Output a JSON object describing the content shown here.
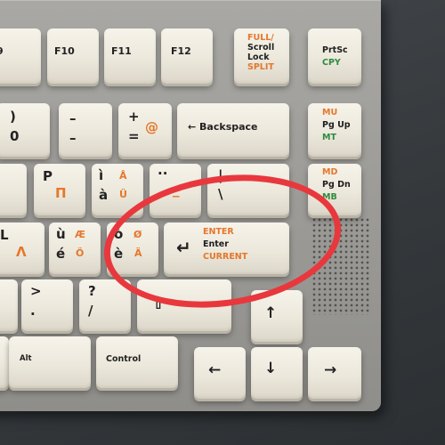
{
  "keys": {
    "f9": "9",
    "f10": "F10",
    "f11": "F11",
    "f12": "F12",
    "scroll_lock": {
      "top": "FULL/",
      "mid1": "Scroll",
      "mid2": "Lock",
      "bottom": "SPLIT"
    },
    "prtsc": {
      "top": "PrtSc",
      "bottom": "CPY"
    },
    "zero": {
      "top": ")",
      "bottom": "0"
    },
    "minus": {
      "top": "–",
      "bottom": "–"
    },
    "equals": {
      "top": "+",
      "bottom": "=",
      "alt": "@"
    },
    "backspace": "← Backspace",
    "pgup": {
      "top": "MU",
      "mid": "Pg Up",
      "bottom": "MT"
    },
    "p": {
      "top": "P",
      "alt": "Π"
    },
    "agrave": {
      "top": "ì",
      "mid": "Å",
      "bottom": "à",
      "alt": "Ü"
    },
    "brackets": {
      "top": "··",
      "bottom": "_"
    },
    "backslash": {
      "top": "|",
      "bottom": "\\"
    },
    "pgdn": {
      "top": "MD",
      "mid": "Pg Dn",
      "bottom": "MB"
    },
    "l": {
      "top": "L",
      "alt": "Λ"
    },
    "ugrave": {
      "top": "ù",
      "mid": "Æ",
      "bottom": "é",
      "alt": "Ö"
    },
    "ograve": {
      "top": "ò",
      "mid": "Ø",
      "bottom": "è",
      "alt": "Ä"
    },
    "enter": {
      "top": "ENTER",
      "mid": "Enter",
      "bottom": "CURRENT",
      "arrow": "↵"
    },
    "gt": {
      "top": ">",
      "bottom": "."
    },
    "question": {
      "top": "?",
      "bottom": "/"
    },
    "shift": "⇧",
    "up": "↑",
    "alt_key": "Alt",
    "control": "Control",
    "left": "←",
    "down": "↓",
    "right": "→"
  },
  "annotation": {
    "color": "#e8383d"
  }
}
